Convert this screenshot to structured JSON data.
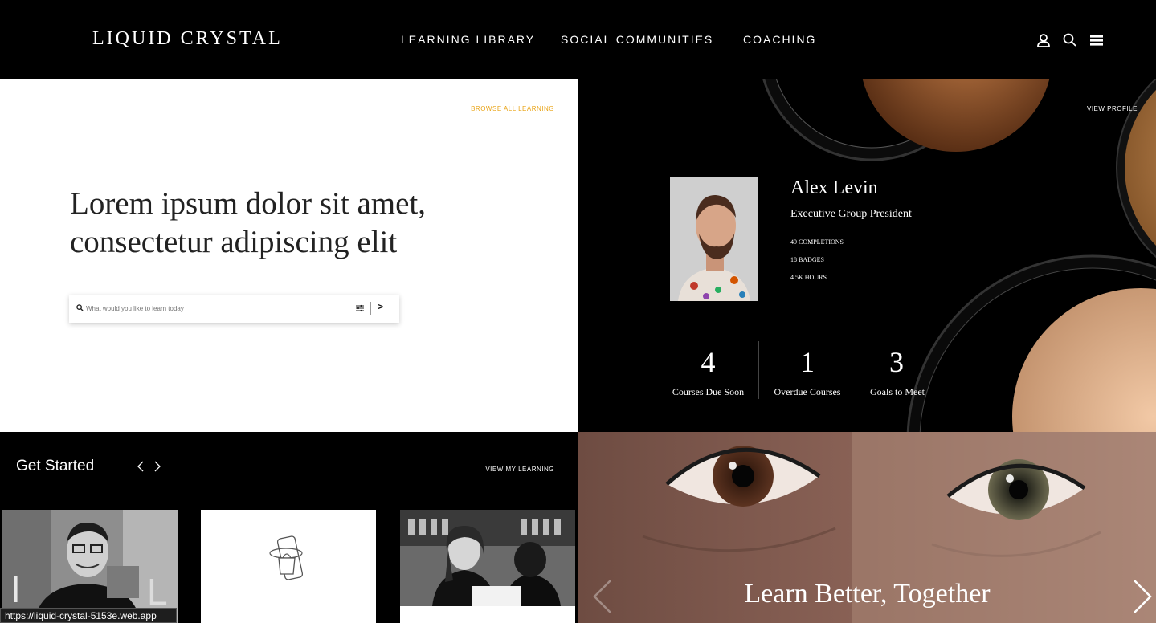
{
  "header": {
    "logo": "LIQUID CRYSTAL",
    "nav": [
      "LEARNING LIBRARY",
      "SOCIAL COMMUNITIES",
      "COACHING"
    ],
    "icons": [
      "user-icon",
      "search-icon",
      "menu-icon"
    ]
  },
  "hero": {
    "browse_link": "BROWSE ALL LEARNING",
    "headline_line1": "Lorem ipsum dolor sit amet,",
    "headline_line2": "consectetur adipiscing elit",
    "search_placeholder": "What would you like to learn today",
    "submit_label": ">"
  },
  "profile": {
    "view_profile": "VIEW PROFILE",
    "name": "Alex Levin",
    "title": "Executive Group President",
    "completions": "49 COMPLETIONS",
    "badges": "18 BADGES",
    "hours": "4.5K HOURS",
    "stats": [
      {
        "value": "4",
        "label": "Courses Due Soon"
      },
      {
        "value": "1",
        "label": "Overdue Courses"
      },
      {
        "value": "3",
        "label": "Goals to Meet"
      }
    ]
  },
  "get_started": {
    "title": "Get Started",
    "view_link": "VIEW MY LEARNING"
  },
  "banner": {
    "text": "Learn Better, Together"
  },
  "status_url": "https://liquid-crystal-5153e.web.app",
  "colors": {
    "accent": "#e9a417",
    "background": "#000000",
    "panel": "#ffffff"
  }
}
